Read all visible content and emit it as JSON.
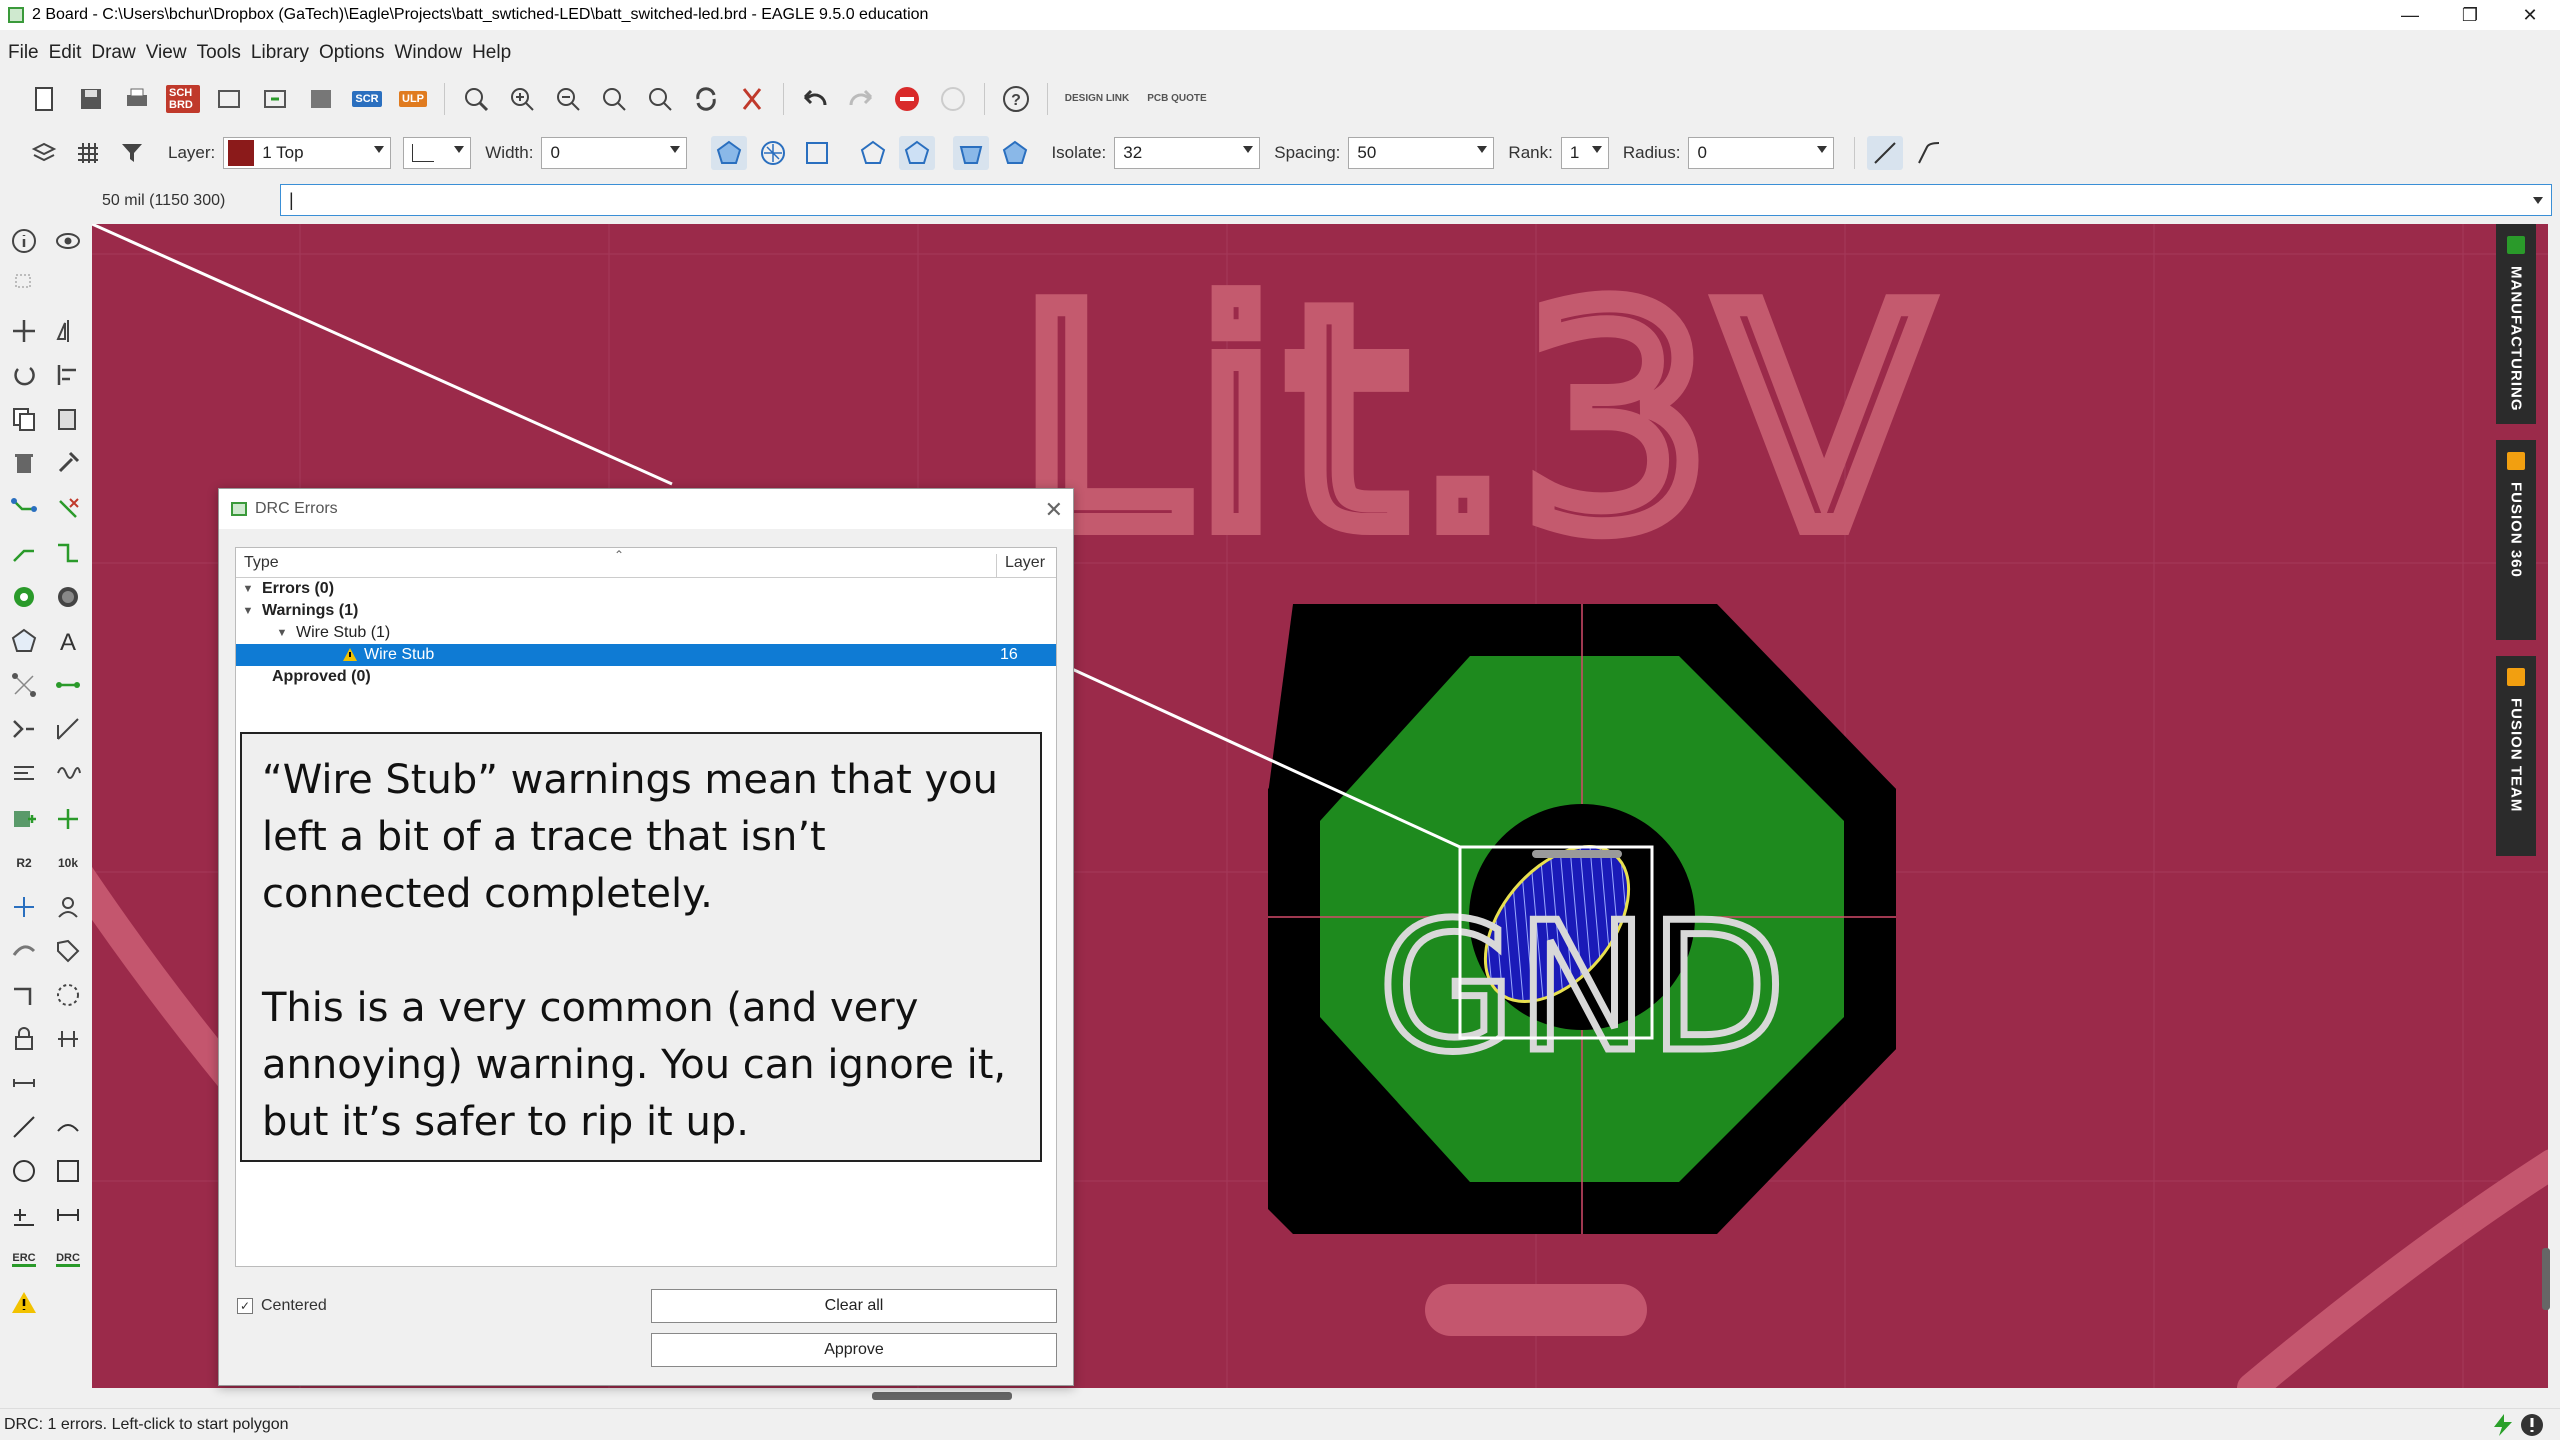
{
  "window": {
    "title": "2 Board - C:\\Users\\bchur\\Dropbox (GaTech)\\Eagle\\Projects\\batt_swtiched-LED\\batt_switched-led.brd - EAGLE 9.5.0 education"
  },
  "menu": [
    "File",
    "Edit",
    "Draw",
    "View",
    "Tools",
    "Library",
    "Options",
    "Window",
    "Help"
  ],
  "toolbar1": {
    "sch_brd_label": "SCH BRD",
    "scr_label": "SCR",
    "ulp_label": "ULP",
    "design_link_label": "DESIGN LINK",
    "pcb_quote_label": "PCB QUOTE"
  },
  "toolbar2": {
    "layer_label": "Layer:",
    "layer_value": "1 Top",
    "layer_color": "#8b1a1a",
    "width_label": "Width:",
    "width_value": "0",
    "isolate_label": "Isolate:",
    "isolate_value": "32",
    "spacing_label": "Spacing:",
    "spacing_value": "50",
    "rank_label": "Rank:",
    "rank_value": "1",
    "radius_label": "Radius:",
    "radius_value": "0"
  },
  "command": {
    "coords": "50 mil (1150 300)",
    "value": "|"
  },
  "left_tools": {
    "r2_label": "R2",
    "tenk_label": "10k",
    "erc_label": "ERC",
    "drc_label": "DRC"
  },
  "canvas": {
    "silk_text": "Lit.3V",
    "pad_label": "GND",
    "bg_color": "#9b2a4a"
  },
  "right_tabs": [
    "MANUFACTURING",
    "FUSION 360",
    "FUSION TEAM"
  ],
  "drc_dialog": {
    "title": "DRC Errors",
    "col_type": "Type",
    "col_layer": "Layer",
    "rows": [
      {
        "label": "Errors (0)"
      },
      {
        "label": "Warnings (1)"
      },
      {
        "label": "Wire Stub (1)"
      },
      {
        "label": "Wire Stub",
        "layer": "16"
      },
      {
        "label": "Approved (0)"
      }
    ],
    "centered_label": "Centered",
    "clear_all": "Clear all",
    "approve": "Approve"
  },
  "note": {
    "para1": "“Wire Stub” warnings mean that you left a bit of a trace that isn’t connected completely.",
    "para2": "This is a very common (and very annoying) warning. You can ignore it, but it’s safer to rip it up."
  },
  "status": {
    "text": "DRC: 1 errors. Left-click to start polygon"
  }
}
